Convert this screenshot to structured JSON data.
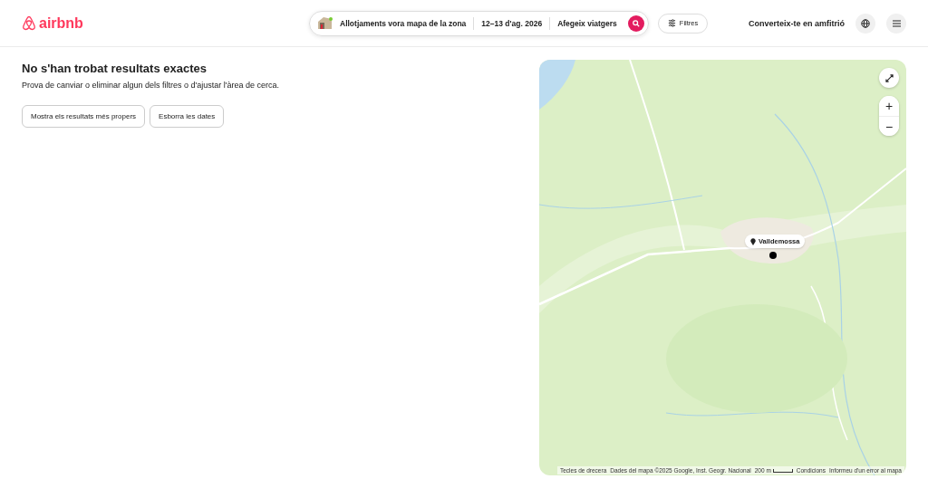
{
  "header": {
    "logo_text": "airbnb",
    "search": {
      "location": "Allotjaments vora mapa de la zona",
      "dates": "12–13 d'ag. 2026",
      "guests": "Afegeix viatgers"
    },
    "filters_button": "Filtres",
    "host_link": "Converteix-te en amfitrió"
  },
  "results": {
    "title": "No s'han trobat resultats exactes",
    "message": "Prova de canviar o eliminar algun dels filtres o d'ajustar l'àrea de cerca.",
    "buttons": [
      "Mostra els resultats més propers",
      "Esborra les dates"
    ]
  },
  "map": {
    "kind": "picture",
    "pin_label": "Valldemossa",
    "zoom_in": "+",
    "zoom_out": "−",
    "footer": [
      "Tecles de drecera",
      "Dades del mapa ©2025 Google, Inst. Geogr. Nacional",
      "200 m",
      "Condicions",
      "Informeu d'un error al mapa"
    ]
  }
}
